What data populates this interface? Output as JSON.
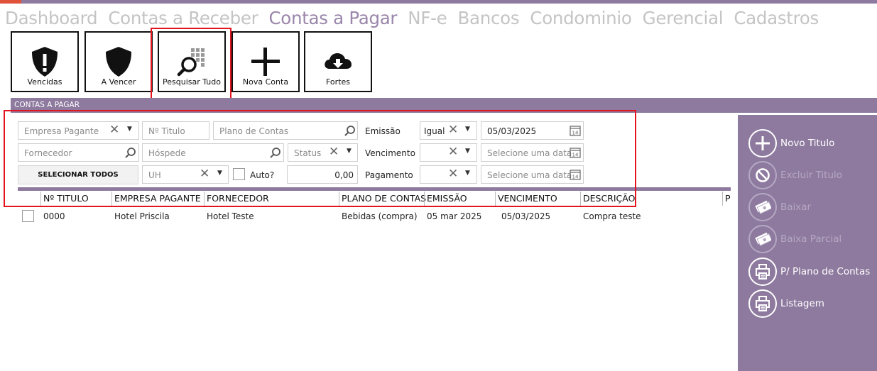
{
  "nav": {
    "items": [
      "Dashboard",
      "Contas a Receber",
      "Contas a Pagar",
      "NF-e",
      "Bancos",
      "Condominio",
      "Gerencial",
      "Cadastros"
    ],
    "active": "Contas a Pagar"
  },
  "toolbar": {
    "vencidas": "Vencidas",
    "a_vencer": "A Vencer",
    "pesquisar": "Pesquisar Tudo",
    "nova_conta": "Nova Conta",
    "fortes": "Fortes"
  },
  "section": {
    "title": "CONTAS A PAGAR"
  },
  "filters": {
    "empresa_pagante": "Empresa Pagante",
    "num_titulo": "Nº Titulo",
    "plano_contas": "Plano de Contas",
    "emissao_label": "Emissão",
    "emissao_op": "Igual",
    "emissao_date": "05/03/2025",
    "fornecedor": "Fornecedor",
    "hospede": "Hóspede",
    "status": "Status",
    "vencimento_label": "Vencimento",
    "vencimento_date_ph": "Selecione uma data",
    "selecionar_todos": "SELECIONAR TODOS",
    "uh": "UH",
    "auto_label": "Auto?",
    "valor": "0,00",
    "pagamento_label": "Pagamento",
    "pagamento_date_ph": "Selecione uma data",
    "cal_day": "14"
  },
  "table": {
    "columns": [
      "Nº TITULO",
      "EMPRESA PAGANTE",
      "FORNECEDOR",
      "PLANO DE CONTAS",
      "EMISSÃO",
      "VENCIMENTO",
      "DESCRIÇÃO",
      "P"
    ],
    "rows": [
      {
        "titulo": "0000",
        "empresa": "Hotel Priscila",
        "fornecedor": "Hotel Teste",
        "plano": "Bebidas (compra)",
        "emissao": "05 mar 2025",
        "vencimento": "05/03/2025",
        "descricao": "Compra teste"
      }
    ]
  },
  "actions": {
    "novo_titulo": "Novo Titulo",
    "excluir_titulo": "Excluir Titulo",
    "baixar": "Baixar",
    "baixa_parcial": "Baixa Parcial",
    "plano_contas": "P/ Plano de Contas",
    "listagem": "Listagem"
  },
  "colors": {
    "accent": "#8e7a9f",
    "highlight": "#e3141e",
    "nav_inactive": "#c4c4c4",
    "nav_active": "#9a86aa"
  },
  "icons": [
    "warning-shield-icon",
    "shield-icon",
    "search-grid-icon",
    "plus-icon",
    "cloud-download-icon",
    "magnifier-icon",
    "calendar-icon",
    "clear-x-icon",
    "chevron-down-icon",
    "plus-circle-icon",
    "block-icon",
    "money-icon",
    "printer-icon"
  ]
}
